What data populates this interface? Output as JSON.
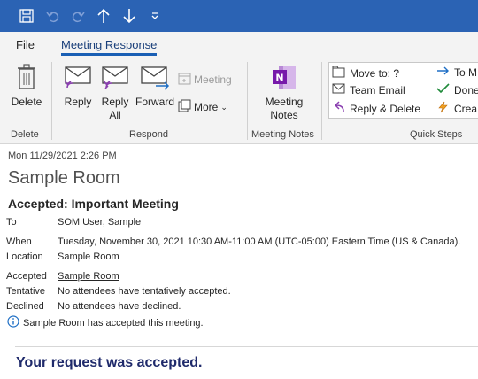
{
  "window": {
    "title_bar_color": "#2b63b4"
  },
  "quick_access": {
    "icons": [
      "save-icon",
      "undo-icon",
      "redo-icon",
      "up-arrow-icon",
      "down-arrow-icon",
      "customize-icon"
    ]
  },
  "menu": {
    "tabs": [
      {
        "label": "File"
      },
      {
        "label": "Meeting Response"
      }
    ]
  },
  "ribbon": {
    "delete_group": {
      "delete_label": "Delete",
      "group_label": "Delete"
    },
    "respond_group": {
      "reply_label": "Reply",
      "reply_all_line1": "Reply",
      "reply_all_line2": "All",
      "forward_label": "Forward",
      "meeting_label": "Meeting",
      "more_label": "More",
      "group_label": "Respond"
    },
    "meeting_notes_group": {
      "btn_line1": "Meeting",
      "btn_line2": "Notes",
      "group_label": "Meeting Notes"
    },
    "quick_steps": {
      "items": [
        {
          "label": "Move to: ?"
        },
        {
          "label": "Team Email"
        },
        {
          "label": "Reply & Delete"
        },
        {
          "label": "To M"
        },
        {
          "label": "Done"
        },
        {
          "label": "Crea"
        }
      ],
      "group_label": "Quick Steps"
    }
  },
  "message": {
    "date": "Mon 11/29/2021 2:26 PM",
    "sender": "Sample Room",
    "response": "Accepted: Important Meeting",
    "fields": {
      "to_label": "To",
      "to_value": "SOM User, Sample",
      "when_label": "When",
      "when_value": "Tuesday, November 30, 2021 10:30 AM-11:00 AM (UTC-05:00) Eastern Time (US & Canada).",
      "location_label": "Location",
      "location_value": "Sample Room",
      "accepted_label": "Accepted",
      "accepted_value": "Sample Room",
      "tentative_label": "Tentative",
      "tentative_value": "No attendees have tentatively accepted.",
      "declined_label": "Declined",
      "declined_value": "No attendees have declined."
    },
    "info_text": "Sample Room has accepted this meeting.",
    "body_text": "Your request was accepted."
  }
}
